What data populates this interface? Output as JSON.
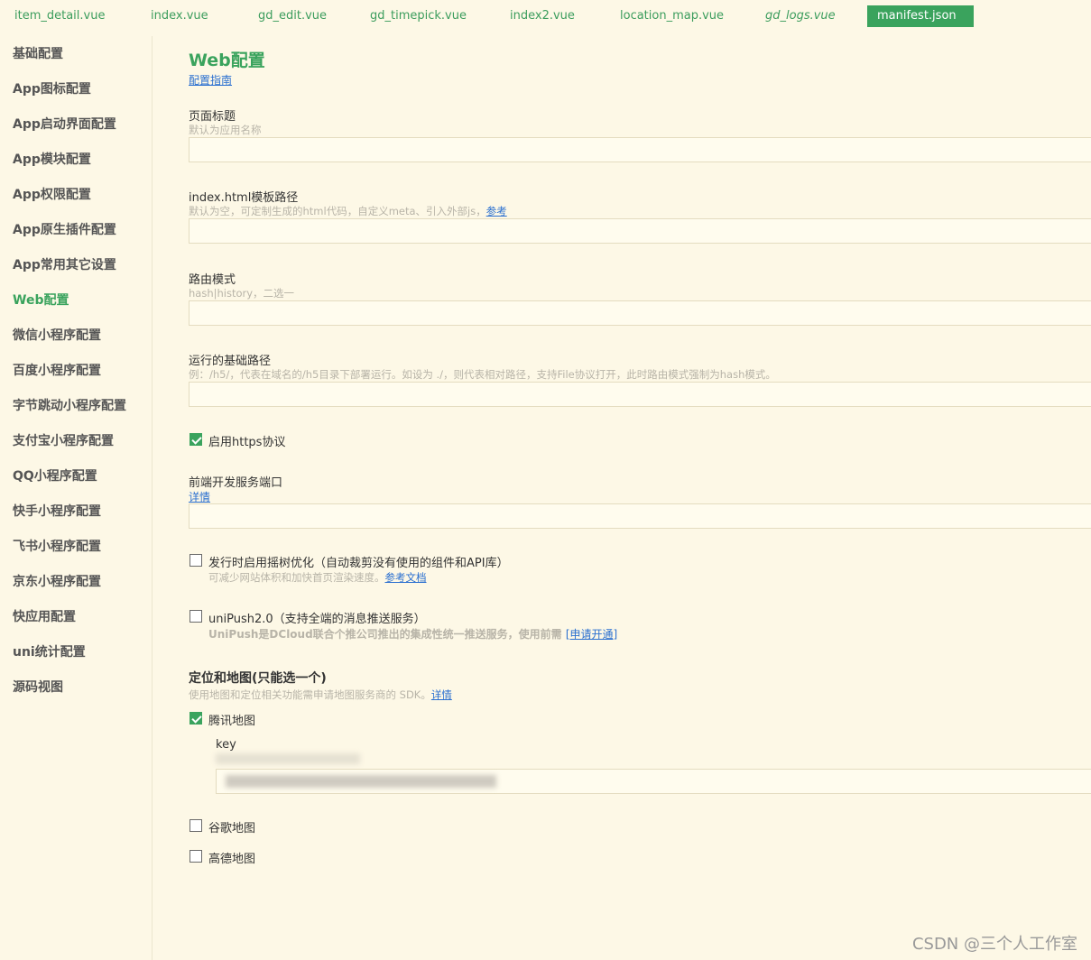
{
  "tabs": [
    {
      "label": "item_detail.vue"
    },
    {
      "label": "index.vue"
    },
    {
      "label": "gd_edit.vue"
    },
    {
      "label": "gd_timepick.vue"
    },
    {
      "label": "index2.vue"
    },
    {
      "label": "location_map.vue"
    },
    {
      "label": "gd_logs.vue"
    },
    {
      "label": "manifest.json"
    }
  ],
  "sidebar": {
    "items": [
      {
        "label": "基础配置"
      },
      {
        "label": "App图标配置"
      },
      {
        "label": "App启动界面配置"
      },
      {
        "label": "App模块配置"
      },
      {
        "label": "App权限配置"
      },
      {
        "label": "App原生插件配置"
      },
      {
        "label": "App常用其它设置"
      },
      {
        "label": "Web配置"
      },
      {
        "label": "微信小程序配置"
      },
      {
        "label": "百度小程序配置"
      },
      {
        "label": "字节跳动小程序配置"
      },
      {
        "label": "支付宝小程序配置"
      },
      {
        "label": "QQ小程序配置"
      },
      {
        "label": "快手小程序配置"
      },
      {
        "label": "飞书小程序配置"
      },
      {
        "label": "京东小程序配置"
      },
      {
        "label": "快应用配置"
      },
      {
        "label": "uni统计配置"
      },
      {
        "label": "源码视图"
      }
    ],
    "active_index": 7
  },
  "main": {
    "title": "Web配置",
    "guide_link": "配置指南",
    "page_title": {
      "label": "页面标题",
      "hint": "默认为应用名称",
      "value": ""
    },
    "template_path": {
      "label": "index.html模板路径",
      "hint": "默认为空，可定制生成的html代码，自定义meta、引入外部js，",
      "link": "参考",
      "value": ""
    },
    "router_mode": {
      "label": "路由模式",
      "hint": "hash|history，二选一",
      "value": ""
    },
    "base_path": {
      "label": "运行的基础路径",
      "hint": "例：/h5/，代表在域名的/h5目录下部署运行。如设为 ./，则代表相对路径，支持File协议打开，此时路由模式强制为hash模式。",
      "value": ""
    },
    "https": {
      "label": "启用https协议",
      "checked": true
    },
    "dev_port": {
      "label": "前端开发服务端口",
      "link": "详情",
      "value": ""
    },
    "tree_shaking": {
      "label": "发行时启用摇树优化（自动裁剪没有使用的组件和API库）",
      "hint": "可减少网站体积和加快首页渲染速度。",
      "link": "参考文档",
      "checked": false
    },
    "unipush": {
      "label": "uniPush2.0（支持全端的消息推送服务）",
      "hint": "UniPush是DCloud联合个推公司推出的集成性统一推送服务，使用前需",
      "link": "[申请开通]",
      "checked": false
    },
    "maps": {
      "title": "定位和地图(只能选一个)",
      "hint": "使用地图和定位相关功能需申请地图服务商的 SDK。",
      "link": "详情",
      "tencent": {
        "label": "腾讯地图",
        "checked": true,
        "key_label": "key"
      },
      "google": {
        "label": "谷歌地图",
        "checked": false
      },
      "amap": {
        "label": "高德地图",
        "checked": false
      }
    }
  },
  "watermark": "CSDN @三个人工作室",
  "colors": {
    "accent": "#3aa35d",
    "background": "#fdf8e6",
    "link": "#2a6fd0"
  }
}
